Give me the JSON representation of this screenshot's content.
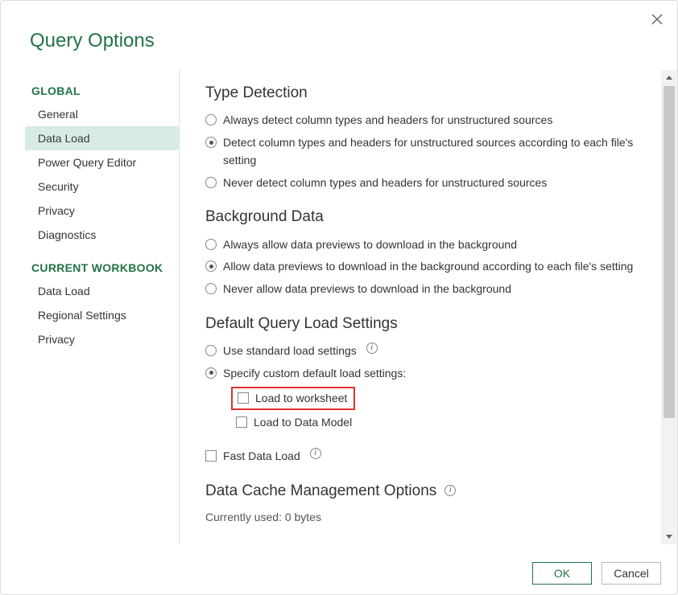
{
  "title": "Query Options",
  "sidebar": {
    "global": {
      "label": "GLOBAL",
      "items": [
        "General",
        "Data Load",
        "Power Query Editor",
        "Security",
        "Privacy",
        "Diagnostics"
      ],
      "selectedIndex": 1
    },
    "workbook": {
      "label": "CURRENT WORKBOOK",
      "items": [
        "Data Load",
        "Regional Settings",
        "Privacy"
      ]
    }
  },
  "content": {
    "typeDetection": {
      "title": "Type Detection",
      "options": [
        "Always detect column types and headers for unstructured sources",
        "Detect column types and headers for unstructured sources according to each file's setting",
        "Never detect column types and headers for unstructured sources"
      ],
      "selected": 1
    },
    "backgroundData": {
      "title": "Background Data",
      "options": [
        "Always allow data previews to download in the background",
        "Allow data previews to download in the background according to each file's setting",
        "Never allow data previews to download in the background"
      ],
      "selected": 1
    },
    "defaultLoad": {
      "title": "Default Query Load Settings",
      "options": [
        "Use standard load settings",
        "Specify custom default load settings:"
      ],
      "selected": 1,
      "subOptions": {
        "loadWorksheet": "Load to worksheet",
        "loadDataModel": "Load to Data Model"
      }
    },
    "fastDataLoad": "Fast Data Load",
    "cache": {
      "title": "Data Cache Management Options",
      "currently": "Currently used: 0 bytes"
    }
  },
  "footer": {
    "ok": "OK",
    "cancel": "Cancel"
  }
}
